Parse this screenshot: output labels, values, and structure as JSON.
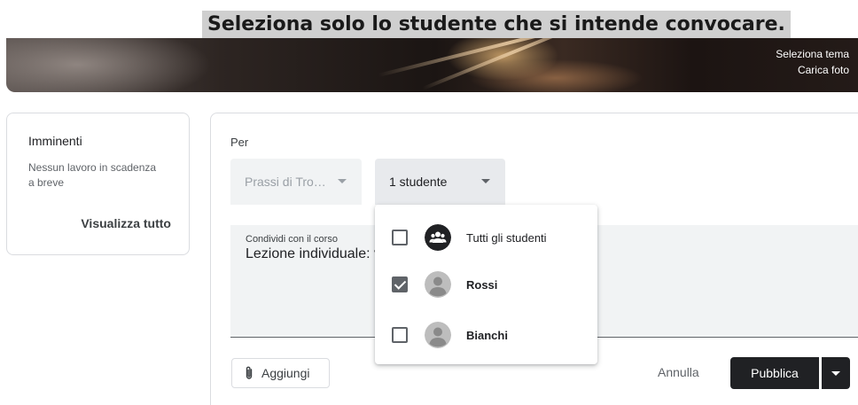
{
  "caption": "Seleziona solo lo studente che si intende convocare.",
  "banner": {
    "select_theme": "Seleziona tema",
    "upload_photo": "Carica foto"
  },
  "upcoming": {
    "title": "Imminenti",
    "empty_text": "Nessun lavoro in scadenza a breve",
    "view_all": "Visualizza tutto"
  },
  "form": {
    "for_label": "Per",
    "course_select": "Prassi di Tro…",
    "students_select": "1 studente",
    "share_label": "Condividi con il corso",
    "share_text": "Lezione individuale: v",
    "add_button": "Aggiungi",
    "cancel_button": "Annulla",
    "publish_button": "Pubblica"
  },
  "student_menu": {
    "items": [
      {
        "label": "Tutti gli studenti",
        "checked": false,
        "icon": "group-icon"
      },
      {
        "label": "Rossi",
        "checked": true,
        "icon": "person-avatar-icon"
      },
      {
        "label": "Bianchi",
        "checked": false,
        "icon": "person-avatar-icon"
      }
    ]
  },
  "colors": {
    "accent_dark": "#202124",
    "field_bg": "#f1f3f4",
    "caption_bg": "#cfcfcf"
  }
}
